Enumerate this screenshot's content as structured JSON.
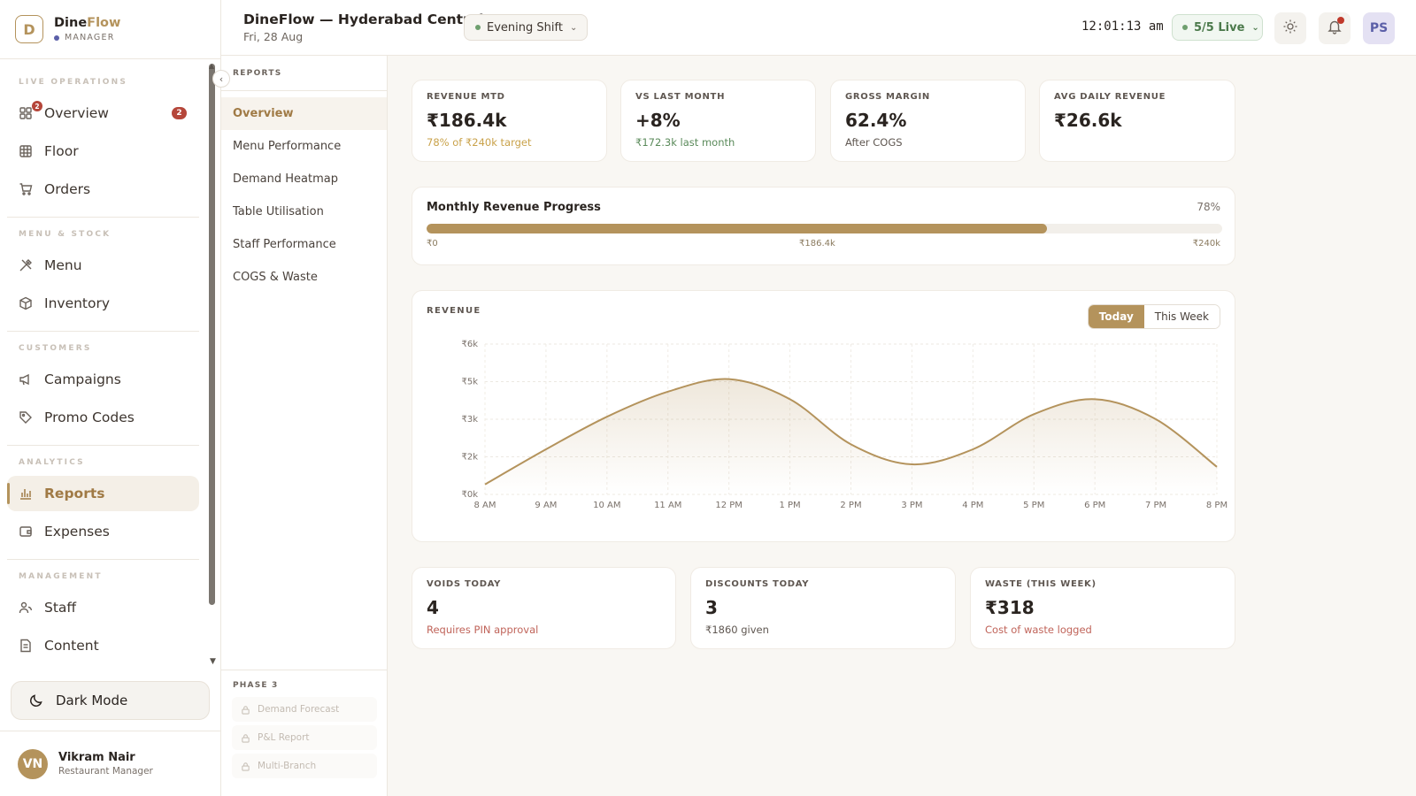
{
  "brand": {
    "name_a": "Dine",
    "name_b": "Flow",
    "role": "MANAGER",
    "logo_glyph": "D"
  },
  "sidebar": {
    "sections": [
      "LIVE OPERATIONS",
      "MENU & STOCK",
      "CUSTOMERS",
      "ANALYTICS",
      "MANAGEMENT"
    ],
    "items": [
      {
        "label": "Overview",
        "icon": "dashboard-icon",
        "badge": "2",
        "icon_badge": "2"
      },
      {
        "label": "Floor",
        "icon": "grid-icon"
      },
      {
        "label": "Orders",
        "icon": "cart-icon"
      },
      {
        "label": "Menu",
        "icon": "utensils-icon"
      },
      {
        "label": "Inventory",
        "icon": "box-icon"
      },
      {
        "label": "Campaigns",
        "icon": "megaphone-icon"
      },
      {
        "label": "Promo Codes",
        "icon": "tag-icon"
      },
      {
        "label": "Reports",
        "icon": "bar-chart-icon",
        "active": true
      },
      {
        "label": "Expenses",
        "icon": "wallet-icon"
      },
      {
        "label": "Staff",
        "icon": "users-icon"
      },
      {
        "label": "Content",
        "icon": "file-icon"
      }
    ],
    "dark_mode_label": "Dark Mode",
    "user": {
      "initials": "VN",
      "name": "Vikram Nair",
      "role": "Restaurant Manager"
    }
  },
  "topbar": {
    "title": "DineFlow — Hyderabad Central",
    "date": "Fri, 28 Aug",
    "shift": "Evening Shift",
    "clock": "12:01:13 am",
    "live": "5/5 Live",
    "profile_initials": "PS"
  },
  "subnav": {
    "title": "REPORTS",
    "items": [
      "Overview",
      "Menu Performance",
      "Demand Heatmap",
      "Table Utilisation",
      "Staff Performance",
      "COGS & Waste"
    ],
    "active_index": 0,
    "phase_title": "PHASE 3",
    "phase_items": [
      "Demand Forecast",
      "P&L Report",
      "Multi-Branch"
    ]
  },
  "kpis": [
    {
      "label": "REVENUE MTD",
      "value": "₹186.4k",
      "sub": "78% of ₹240k target",
      "sub_color": "#c9a24a"
    },
    {
      "label": "VS LAST MONTH",
      "value": "+8%",
      "sub": "₹172.3k last month",
      "sub_color": "#5a8a5a"
    },
    {
      "label": "GROSS MARGIN",
      "value": "62.4%",
      "sub": "After COGS",
      "sub_color": "#5f5751"
    },
    {
      "label": "AVG DAILY REVENUE",
      "value": "₹26.6k",
      "sub": "",
      "sub_color": "#5f5751"
    }
  ],
  "progress": {
    "title": "Monthly Revenue Progress",
    "pct_label": "78%",
    "fraction": 0.78,
    "start": "₹0",
    "current": "₹186.4k",
    "end": "₹240k"
  },
  "revenue": {
    "label": "REVENUE",
    "toggle": [
      "Today",
      "This Week"
    ],
    "active_toggle": 0
  },
  "chart_data": {
    "type": "area",
    "title": "REVENUE",
    "categories": [
      "8 AM",
      "9 AM",
      "10 AM",
      "11 AM",
      "12 PM",
      "1 PM",
      "2 PM",
      "3 PM",
      "4 PM",
      "5 PM",
      "6 PM",
      "7 PM",
      "8 PM"
    ],
    "values": [
      400,
      1800,
      3100,
      4100,
      4600,
      3800,
      2000,
      1200,
      1800,
      3200,
      3800,
      3000,
      1100
    ],
    "y_ticks": [
      "₹0k",
      "₹2k",
      "₹3k",
      "₹5k",
      "₹6k"
    ],
    "y_tick_values": [
      0,
      1500,
      3000,
      4500,
      6000
    ],
    "ylim": [
      0,
      6000
    ],
    "grid": true,
    "line_color": "#b4935c"
  },
  "bottom_cards": [
    {
      "label": "VOIDS TODAY",
      "value": "4",
      "sub": "Requires PIN approval",
      "sub_color": "#c0645a"
    },
    {
      "label": "DISCOUNTS TODAY",
      "value": "3",
      "sub": "₹1860 given",
      "sub_color": "#5f5751"
    },
    {
      "label": "WASTE (THIS WEEK)",
      "value": "₹318",
      "sub": "Cost of waste logged",
      "sub_color": "#c0645a"
    }
  ]
}
